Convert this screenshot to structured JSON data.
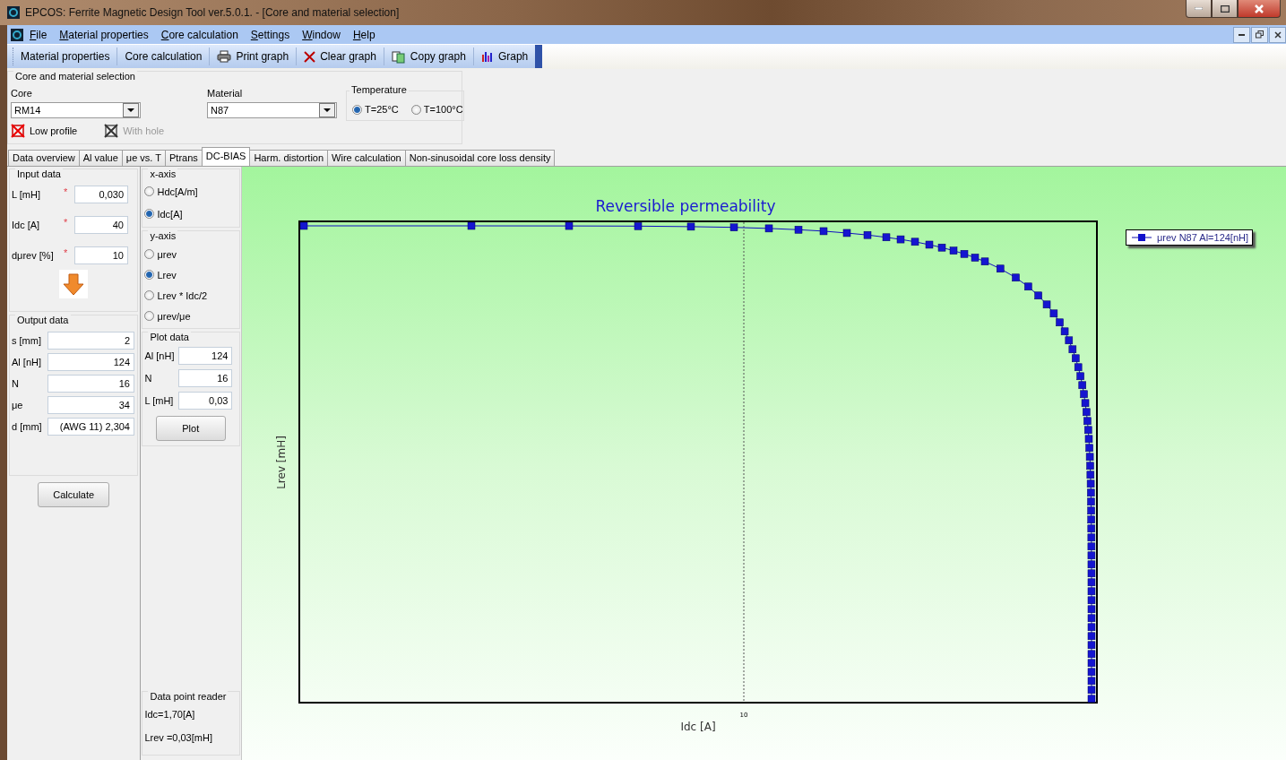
{
  "window": {
    "title": "EPCOS: Ferrite Magnetic Design Tool ver.5.0.1. - [Core and material selection]"
  },
  "menu": [
    {
      "label": "File"
    },
    {
      "label": "Material properties"
    },
    {
      "label": "Core calculation"
    },
    {
      "label": "Settings"
    },
    {
      "label": "Window"
    },
    {
      "label": "Help"
    }
  ],
  "toolbar": [
    {
      "label": "Material properties",
      "kind": "text"
    },
    {
      "label": "Core calculation",
      "kind": "text"
    },
    {
      "label": "Print graph",
      "kind": "print"
    },
    {
      "label": "Clear graph",
      "kind": "clear"
    },
    {
      "label": "Copy graph",
      "kind": "copy"
    },
    {
      "label": "Graph",
      "kind": "graph"
    }
  ],
  "core_selection": {
    "title": "Core and material selection",
    "core": {
      "label": "Core",
      "value": "RM14"
    },
    "material": {
      "label": "Material",
      "value": "N87"
    },
    "temperature": {
      "title": "Temperature",
      "options": [
        {
          "label": "T=25°C",
          "selected": true
        },
        {
          "label": "T=100°C",
          "selected": false
        }
      ]
    },
    "toggles": [
      {
        "label": "Low profile",
        "disabled": false
      },
      {
        "label": "With hole",
        "disabled": true
      }
    ]
  },
  "tabs": [
    {
      "label": "Data overview",
      "selected": false
    },
    {
      "label": "Al value",
      "selected": false
    },
    {
      "label": "μe vs. T",
      "selected": false
    },
    {
      "label": "Ptrans",
      "selected": false
    },
    {
      "label": "DC-BIAS",
      "selected": true
    },
    {
      "label": "Harm. distortion",
      "selected": false
    },
    {
      "label": "Wire calculation",
      "selected": false
    },
    {
      "label": "Non-sinusoidal core loss density",
      "selected": false
    }
  ],
  "input_data": {
    "title": "Input data",
    "fields": [
      {
        "label": "L [mH]",
        "mark": "*",
        "value": "0,030"
      },
      {
        "label": "Idc [A]",
        "mark": "*",
        "value": "40"
      },
      {
        "label": "dμrev [%]",
        "mark": "*",
        "value": "10"
      }
    ]
  },
  "output_data": {
    "title": "Output data",
    "fields": [
      {
        "label": "s [mm]",
        "value": "2"
      },
      {
        "label": "Al [nH]",
        "value": "124"
      },
      {
        "label": "N",
        "value": "16"
      },
      {
        "label": "μe",
        "value": "34"
      },
      {
        "label": "d [mm]",
        "value": "(AWG 11) 2,304"
      }
    ]
  },
  "calculate_button": "Calculate",
  "x_axis": {
    "title": "x-axis",
    "options": [
      {
        "label": "Hdc[A/m]",
        "selected": false
      },
      {
        "label": "Idc[A]",
        "selected": true
      }
    ]
  },
  "y_axis": {
    "title": "y-axis",
    "options": [
      {
        "label": "μrev",
        "selected": false
      },
      {
        "label": "Lrev",
        "selected": true
      },
      {
        "label": "Lrev * Idc/2",
        "selected": false
      },
      {
        "label": "μrev/μe",
        "selected": false
      }
    ]
  },
  "plot_data": {
    "title": "Plot data",
    "fields": [
      {
        "label": "Al [nH]",
        "value": "124"
      },
      {
        "label": "N",
        "value": "16"
      },
      {
        "label": "L [mH]",
        "value": "0,03"
      }
    ],
    "button": "Plot"
  },
  "data_point_reader": {
    "title": "Data point reader",
    "lines": [
      "Idc=1,70[A]",
      "Lrev =0,03[mH]"
    ]
  },
  "chart": {
    "title": "Reversible permeability",
    "xlabel": "Idc [A]",
    "ylabel": "Lrev [mH]",
    "x_tick_label": "10",
    "legend": "μrev N87 Al=124[nH]"
  }
}
